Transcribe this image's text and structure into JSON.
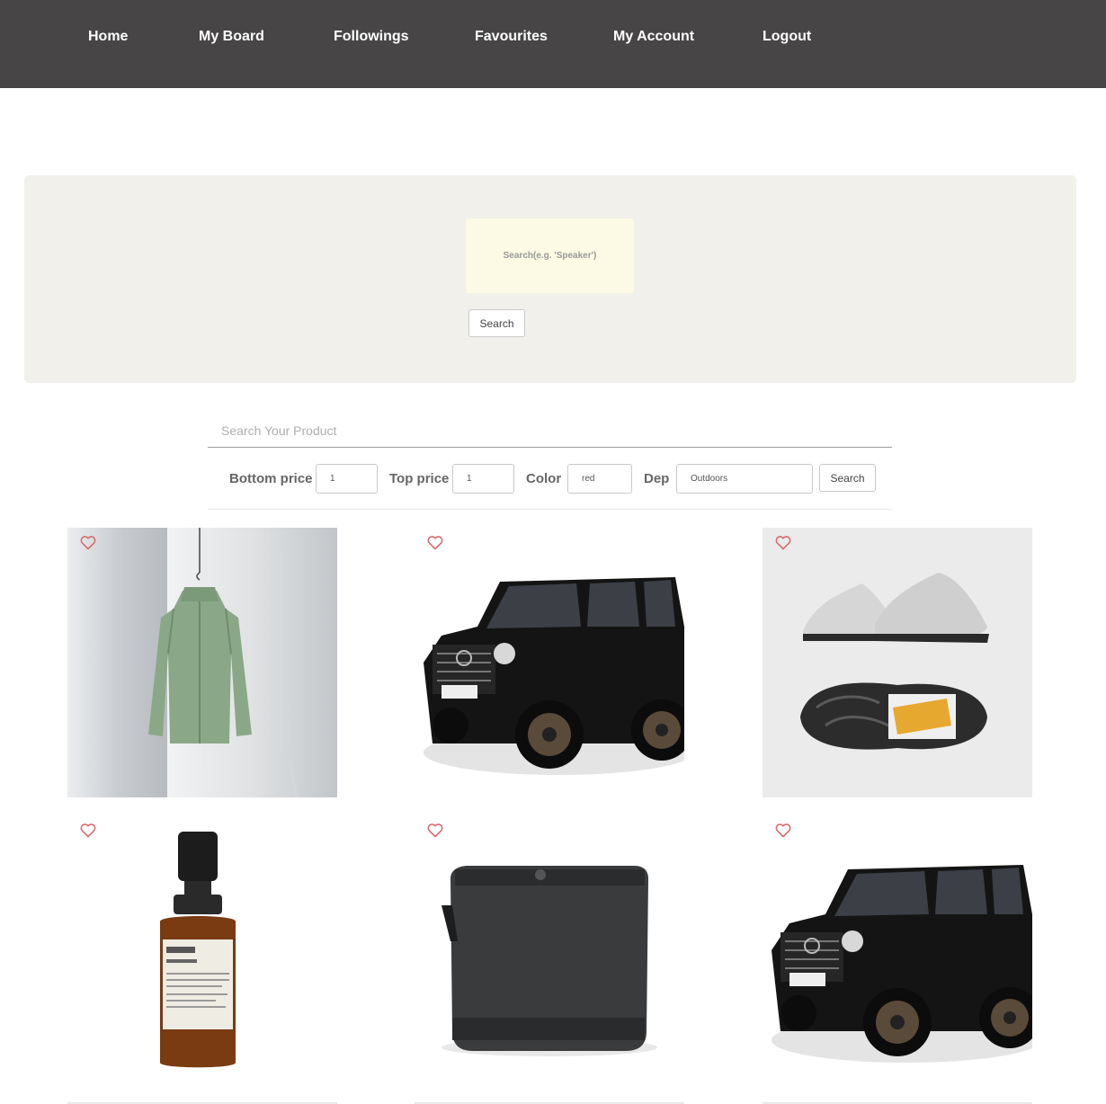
{
  "nav": {
    "items": [
      {
        "label": "Home"
      },
      {
        "label": "My Board"
      },
      {
        "label": "Followings"
      },
      {
        "label": "Favourites"
      },
      {
        "label": "My Account"
      },
      {
        "label": "Logout"
      }
    ]
  },
  "hero": {
    "search_placeholder": "Search(e.g. 'Speaker')",
    "search_button": "Search"
  },
  "product_search": {
    "placeholder": "Search Your Product",
    "filters": {
      "bottom_price_label": "Bottom price",
      "bottom_price_value": "1",
      "top_price_label": "Top price",
      "top_price_value": "1",
      "color_label": "Color",
      "color_value": "red",
      "dep_label": "Dep",
      "dep_value": "Outdoors"
    },
    "search_button": "Search"
  },
  "products": [
    {
      "image": "green-jacket-image",
      "favourite_icon": "heart-outline-icon"
    },
    {
      "image": "black-suv-image",
      "favourite_icon": "heart-outline-icon"
    },
    {
      "image": "grey-sneakers-image",
      "favourite_icon": "heart-outline-icon"
    },
    {
      "image": "deodorant-bottle-image",
      "favourite_icon": "heart-outline-icon"
    },
    {
      "image": "bluetooth-speaker-image",
      "favourite_icon": "heart-outline-icon"
    },
    {
      "image": "black-suv-image",
      "favourite_icon": "heart-outline-icon"
    }
  ],
  "colors": {
    "nav_bg": "#474546",
    "hero_bg": "#f1f0eb",
    "hero_input_bg": "#fcf9e4",
    "heart": "#d96b6b"
  }
}
